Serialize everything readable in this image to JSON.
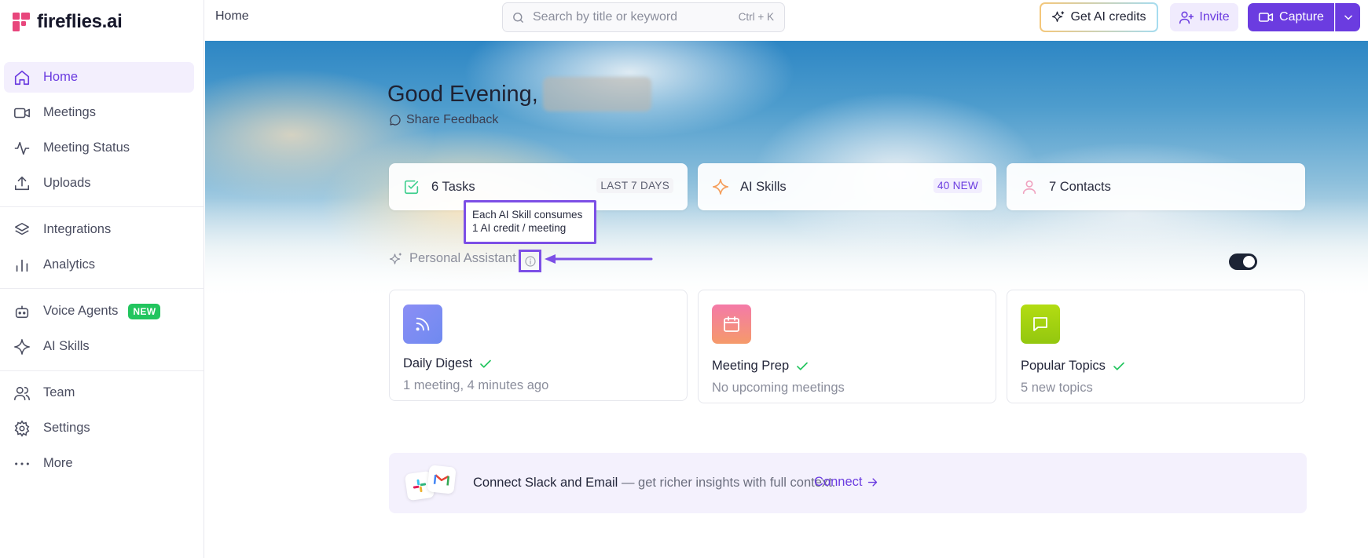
{
  "brand": {
    "name": "fireflies.ai"
  },
  "sidebar": {
    "items": [
      {
        "label": "Home",
        "icon": "home-icon",
        "active": true
      },
      {
        "label": "Meetings",
        "icon": "video-icon"
      },
      {
        "label": "Meeting Status",
        "icon": "activity-icon"
      },
      {
        "label": "Uploads",
        "icon": "upload-icon"
      },
      {
        "label": "Integrations",
        "icon": "layers-icon"
      },
      {
        "label": "Analytics",
        "icon": "bar-chart-icon"
      },
      {
        "label": "Voice Agents",
        "icon": "robot-icon",
        "badge": "NEW"
      },
      {
        "label": "AI Skills",
        "icon": "sparkle-icon"
      },
      {
        "label": "Team",
        "icon": "users-icon"
      },
      {
        "label": "Settings",
        "icon": "gear-icon"
      },
      {
        "label": "More",
        "icon": "more-dots-icon"
      }
    ]
  },
  "topbar": {
    "breadcrumb": "Home",
    "search_placeholder": "Search by title or keyword",
    "search_shortcut": "Ctrl + K",
    "credits_label": "Get AI credits",
    "invite_label": "Invite",
    "capture_label": "Capture"
  },
  "hero": {
    "greeting": "Good Evening,",
    "feedback_label": "Share Feedback"
  },
  "stats": {
    "tasks": {
      "label": "6 Tasks",
      "tag": "LAST 7 DAYS"
    },
    "skills": {
      "label": "AI Skills",
      "tag": "40 NEW"
    },
    "contacts": {
      "label": "7 Contacts"
    }
  },
  "tooltip": {
    "line1": "Each AI Skill consumes",
    "line2": "1 AI credit / meeting"
  },
  "assistant": {
    "label": "Personal Assistant",
    "enabled": true
  },
  "features": [
    {
      "title": "Daily Digest",
      "subtitle": "1 meeting, 4 minutes ago",
      "icon": "rss-icon",
      "color": "#7b86f0"
    },
    {
      "title": "Meeting Prep",
      "subtitle": "No upcoming meetings",
      "icon": "calendar-icon",
      "color": "#f27fa0"
    },
    {
      "title": "Popular Topics",
      "subtitle": "5 new topics",
      "icon": "chat-bubble-icon",
      "color": "#a3d311"
    }
  ],
  "connect": {
    "title": "Connect Slack and Email",
    "dash": " — ",
    "description": "get richer insights with full context.",
    "link_label": "Connect"
  },
  "colors": {
    "accent": "#6b3ce0",
    "success": "#22c55e"
  }
}
